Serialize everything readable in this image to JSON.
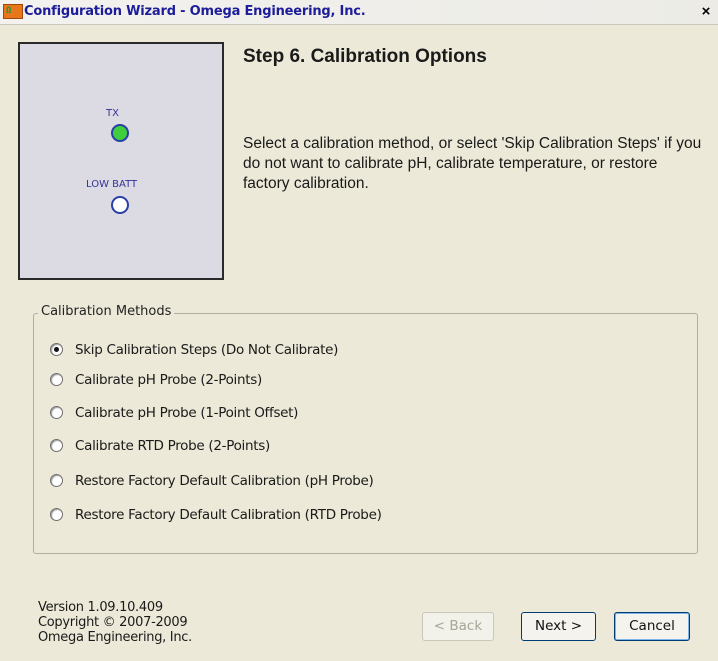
{
  "window": {
    "title": "Configuration Wizard - Omega Engineering, Inc.",
    "app_icon_text": "Ω",
    "close_glyph": "×"
  },
  "led_panel": {
    "tx_label": "TX",
    "tx_color": "#3ece3e",
    "batt_label": "LOW BATT",
    "batt_color": "#ffffff"
  },
  "step": {
    "title": "Step 6.  Calibration Options",
    "instructions": "Select a calibration method, or select 'Skip Calibration Steps' if you do not want to calibrate pH, calibrate temperature, or restore factory calibration."
  },
  "calibration_methods": {
    "legend": "Calibration Methods",
    "selected_index": 0,
    "options": [
      {
        "label": "Skip Calibration Steps (Do Not Calibrate)",
        "checked": true
      },
      {
        "label": "Calibrate pH Probe (2-Points)",
        "checked": false
      },
      {
        "label": "Calibrate pH Probe (1-Point Offset)",
        "checked": false
      },
      {
        "label": "Calibrate RTD Probe (2-Points)",
        "checked": false
      },
      {
        "label": "Restore Factory Default Calibration (pH Probe)",
        "checked": false
      },
      {
        "label": "Restore Factory Default Calibration (RTD Probe)",
        "checked": false
      }
    ]
  },
  "footer": {
    "version": "Version 1.09.10.409",
    "copyright": "Copyright © 2007-2009",
    "company": "Omega Engineering, Inc."
  },
  "buttons": {
    "back": "< Back",
    "back_enabled": false,
    "next": "Next >",
    "cancel": "Cancel"
  }
}
